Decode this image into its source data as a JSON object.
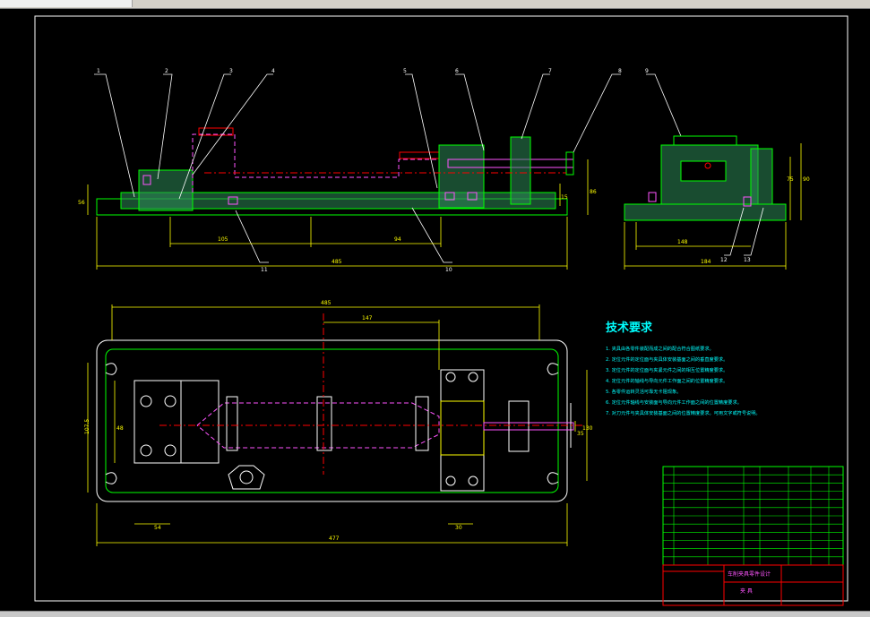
{
  "ui": {
    "scrollbar": "horizontal"
  },
  "colors": {
    "background": "#000000",
    "border": "#ffffff",
    "part": "#00ff00",
    "hatch": "#2e8b57",
    "dimension": "#ffff00",
    "pink": "#ff55ff",
    "red": "#ff0000",
    "cyan": "#00ffff",
    "white": "#ffffff"
  },
  "drawing": {
    "front_view": {
      "callouts": [
        "1",
        "2",
        "3",
        "4",
        "5",
        "6",
        "7",
        "8",
        "9"
      ],
      "bottom_callouts": [
        "11",
        "10"
      ],
      "dims": {
        "bottom_span_left": "105",
        "bottom_span_right": "94",
        "overall": "485",
        "height_left": "56",
        "height_right": "86",
        "small_right": "15"
      }
    },
    "side_view": {
      "callouts_bottom": [
        "12",
        "13"
      ],
      "dims": {
        "width_inner": "148",
        "width_outer": "184",
        "height_a": "75",
        "height_b": "90"
      }
    },
    "top_view": {
      "dims": {
        "overall_top": "485",
        "span_top": "147",
        "height_left": "107.5",
        "inner_left": "48",
        "small_left": "54",
        "overall_bottom": "477",
        "width_right": "130",
        "small_right": "30",
        "stub_right": "35"
      }
    },
    "tech": {
      "title": "技术要求",
      "items": [
        "1. 夹具由各零件装配而成之间的配合符合图纸要求。",
        "2. 定位元件的定位面与夹具体安装基面之间的垂直度要求。",
        "3. 定位元件的定位面与夹紧元件之间的相互位置精度要求。",
        "4. 定位元件的轴线与导向元件工作面之间的位置精度要求。",
        "5. 各零件运转灵活可靠无卡阻现象。",
        "6. 定位元件轴线与安装面与导向元件工作面之间的位置精度要求。",
        "7. 对刀元件与夹具体安装基面之间的位置精度要求。可用文字或符号说明。"
      ]
    },
    "title_block": {
      "title": "车削夹具零件设计",
      "sub": "夹 具",
      "parts_rows": 12
    }
  }
}
